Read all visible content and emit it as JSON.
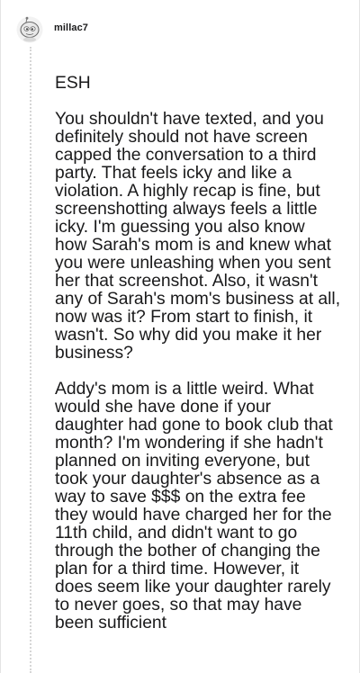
{
  "comment": {
    "username": "millac7",
    "paragraphs": [
      "ESH",
      "You shouldn't have texted, and you definitely should not have screen capped the conversation to a third party. That feels icky and like a violation. A highly recap is fine, but screenshotting always feels a little icky. I'm guessing you also know how Sarah's mom is and knew what you were unleashing when you sent her that screenshot. Also, it wasn't any of Sarah's mom's business at all, now was it? From start to finish, it wasn't. So why did you make it her business?",
      "Addy's mom is a little weird. What would she have done if your daughter had gone to book club that month? I'm wondering if she hadn't planned on inviting everyone, but took your daughter's absence as a way to save $$$ on the extra fee they would have charged her for the 11th child, and didn't want to go through the bother of changing the plan for a third time. However, it does seem like your daughter rarely to never goes, so that may have been sufficient"
    ]
  }
}
